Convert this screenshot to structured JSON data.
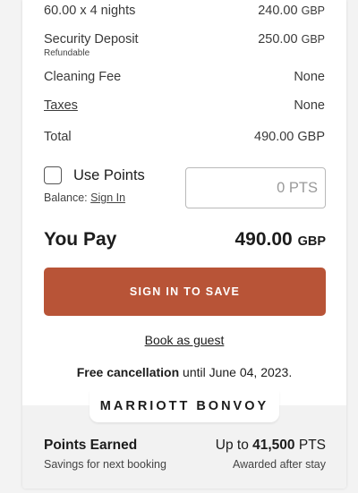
{
  "charges": [
    {
      "label": "60.00 x 4 nights",
      "amount": "240.00",
      "unit": "GBP"
    },
    {
      "label": "Security Deposit",
      "sublabel": "Refundable",
      "amount": "250.00",
      "unit": "GBP"
    },
    {
      "label": "Cleaning Fee",
      "amount": "None"
    },
    {
      "label": "Taxes",
      "amount": "None"
    },
    {
      "label": "Total",
      "amount": "490.00 GBP"
    }
  ],
  "points": {
    "use_label": "Use Points",
    "balance_label": "Balance:",
    "balance_link": "Sign In",
    "input_placeholder": "0 PTS"
  },
  "pay": {
    "label": "You Pay",
    "amount": "490.00",
    "unit": "GBP"
  },
  "actions": {
    "sign_in_label": "SIGN IN TO SAVE",
    "guest_label": "Book as guest"
  },
  "cancellation": {
    "bold": "Free cancellation",
    "rest": " until June 04, 2023."
  },
  "brand": "MARRIOTT BONVOY",
  "earn": {
    "title": "Points Earned",
    "subtitle": "Savings for next booking",
    "prefix": "Up to ",
    "amount": "41,500",
    "unit": " PTS",
    "note": "Awarded after stay"
  },
  "colors": {
    "button": "#b85437",
    "footer_bg": "#f2f2f2"
  }
}
